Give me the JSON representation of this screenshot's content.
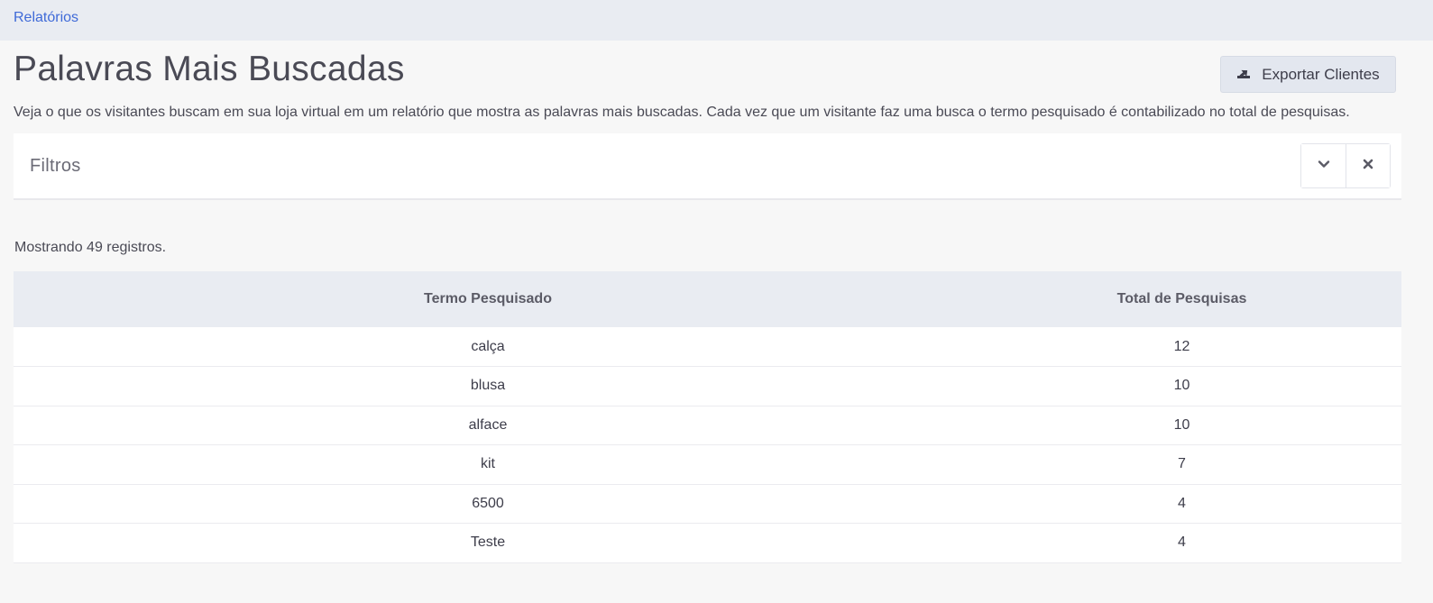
{
  "breadcrumb": {
    "label": "Relatórios"
  },
  "header": {
    "title": "Palavras Mais Buscadas",
    "description": "Veja o que os visitantes buscam em sua loja virtual em um relatório que mostra as palavras mais buscadas. Cada vez que um visitante faz uma busca o termo pesquisado é contabilizado no total de pesquisas.",
    "export_button": {
      "label": "Exportar Clientes",
      "icon": "export-icon"
    }
  },
  "filters": {
    "title": "Filtros",
    "expand_icon": "chevron-down-icon",
    "close_icon": "close-icon"
  },
  "results": {
    "count_text": "Mostrando 49 registros."
  },
  "table": {
    "headers": [
      "Termo Pesquisado",
      "Total de Pesquisas"
    ],
    "rows": [
      {
        "term": "calça",
        "total": "12"
      },
      {
        "term": "blusa",
        "total": "10"
      },
      {
        "term": "alface",
        "total": "10"
      },
      {
        "term": "kit",
        "total": "7"
      },
      {
        "term": "6500",
        "total": "4"
      },
      {
        "term": "Teste",
        "total": "4"
      }
    ]
  },
  "colors": {
    "accent": "#3f6ad8",
    "header_bg": "#e9ecf2",
    "page_bg": "#f7f7f7"
  }
}
